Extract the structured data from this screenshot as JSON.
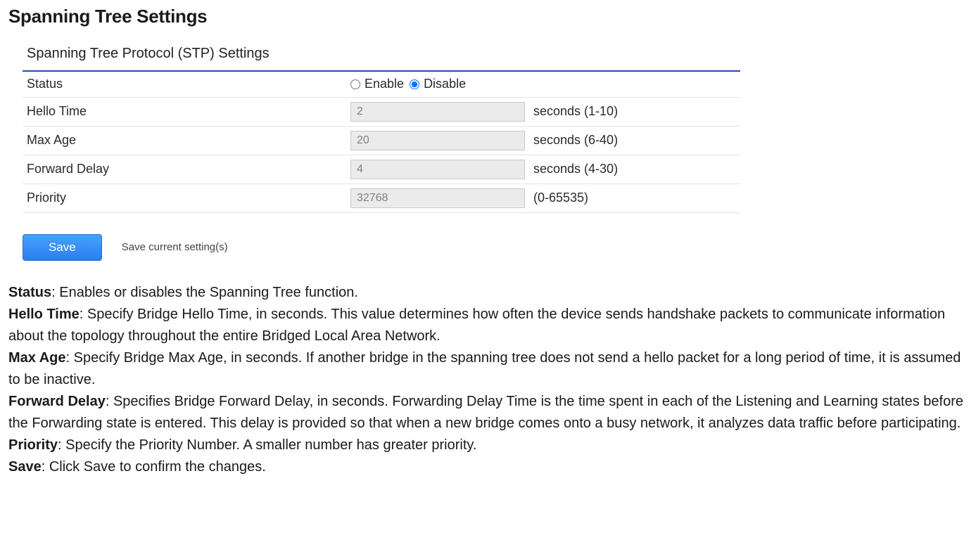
{
  "pageTitle": "Spanning Tree Settings",
  "panelTitle": "Spanning Tree Protocol (STP) Settings",
  "rows": {
    "status": {
      "label": "Status",
      "enable": "Enable",
      "disable": "Disable",
      "selected": "disable"
    },
    "helloTime": {
      "label": "Hello Time",
      "value": "2",
      "hint": "seconds (1-10)"
    },
    "maxAge": {
      "label": "Max Age",
      "value": "20",
      "hint": "seconds (6-40)"
    },
    "forwardDelay": {
      "label": "Forward Delay",
      "value": "4",
      "hint": "seconds (4-30)"
    },
    "priority": {
      "label": "Priority",
      "value": "32768",
      "hint": "(0-65535)"
    }
  },
  "save": {
    "button": "Save",
    "hint": "Save current setting(s)"
  },
  "descriptions": {
    "status": {
      "label": "Status",
      "text": ": Enables or disables the Spanning Tree function."
    },
    "helloTime": {
      "label": "Hello Time",
      "text": ": Specify Bridge Hello Time, in seconds. This value determines how often the device sends handshake packets to communicate information about the topology throughout the entire Bridged Local Area Network."
    },
    "maxAge": {
      "label": "Max Age",
      "text": ": Specify Bridge Max Age, in seconds. If another bridge in the spanning tree does not send a hello packet for a long period of time, it is assumed to be inactive."
    },
    "forwardDelay": {
      "label": "Forward Delay",
      "text": ": Specifies Bridge Forward Delay, in seconds. Forwarding Delay Time is the time spent in each of the Listening and Learning states before the Forwarding state is entered. This delay is provided so that when a new bridge comes onto a busy network, it analyzes data traffic before participating."
    },
    "priority": {
      "label": "Priority",
      "text": ": Specify the Priority Number. A smaller number has greater priority."
    },
    "save": {
      "label": "Save",
      "text": ": Click Save to confirm the changes."
    }
  }
}
